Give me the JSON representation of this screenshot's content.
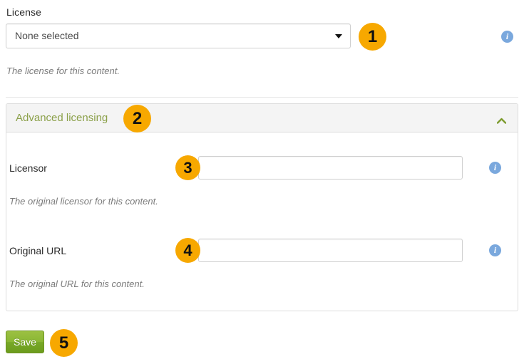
{
  "license_field": {
    "label": "License",
    "select": {
      "value": "None selected",
      "caret_icon": "chevron-down-icon"
    },
    "help_text": "The license for this content.",
    "info_icon": "info-icon",
    "info_glyph": "i"
  },
  "advanced_panel": {
    "title": "Advanced licensing",
    "toggle_icon": "chevron-up-icon",
    "rows": [
      {
        "label": "Licensor",
        "value": "",
        "placeholder": "",
        "help_text": "The original licensor for this content.",
        "info_icon": "info-icon",
        "info_glyph": "i"
      },
      {
        "label": "Original URL",
        "value": "",
        "placeholder": "",
        "help_text": "The original URL for this content.",
        "info_icon": "info-icon",
        "info_glyph": "i"
      }
    ]
  },
  "actions": {
    "save_label": "Save"
  },
  "callouts": [
    {
      "number": "1"
    },
    {
      "number": "2"
    },
    {
      "number": "3"
    },
    {
      "number": "4"
    },
    {
      "number": "5"
    }
  ],
  "colors": {
    "badge": "#f7a800",
    "panel_title": "#8ba049",
    "save_button": "#8ab734",
    "info_icon": "#7aa8dd",
    "border": "#dddddd",
    "panel_header_bg": "#f4f4f4"
  }
}
